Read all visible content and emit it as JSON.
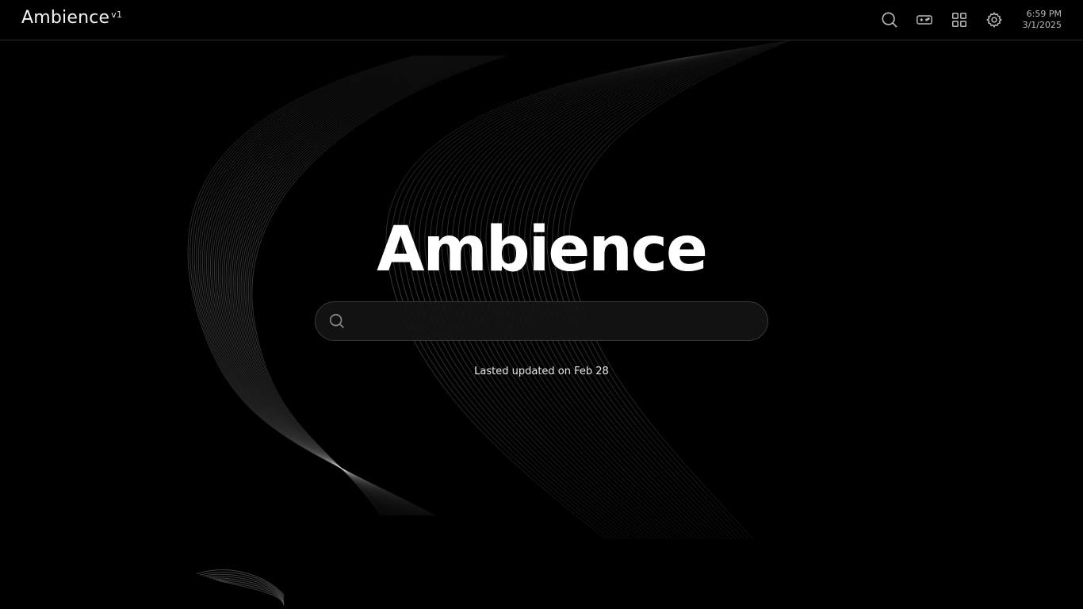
{
  "header": {
    "brand": "Ambience",
    "version": "v1",
    "time": "6:59 PM",
    "date": "3/1/2025",
    "icons": [
      "search-icon",
      "gamepad-icon",
      "apps-grid-icon",
      "settings-gear-icon"
    ]
  },
  "hero": {
    "title": "Ambience",
    "search_value": "",
    "search_placeholder": "",
    "updated_text": "Lasted updated on Feb 28"
  },
  "colors": {
    "background": "#000000",
    "text": "#ffffff",
    "muted": "#bdbdbd",
    "search_bg": "#141414",
    "border": "#3a3a3a"
  }
}
